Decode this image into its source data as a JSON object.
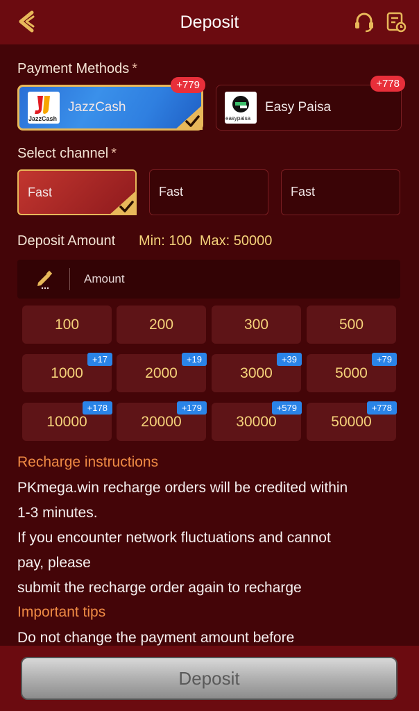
{
  "header": {
    "title": "Deposit"
  },
  "payment_methods": {
    "label": "Payment Methods",
    "required_mark": "*",
    "items": [
      {
        "name": "JazzCash",
        "logo_text": "JazzCash",
        "badge": "+779",
        "selected": true
      },
      {
        "name": "Easy Paisa",
        "logo_text": "easypaisa",
        "badge": "+778",
        "selected": false
      }
    ]
  },
  "channel": {
    "label": "Select channel",
    "required_mark": "*",
    "items": [
      {
        "label": "Fast",
        "selected": true
      },
      {
        "label": "Fast",
        "selected": false
      },
      {
        "label": "Fast",
        "selected": false
      }
    ]
  },
  "deposit_amount": {
    "label": "Deposit Amount",
    "limits": "Min: 100  Max: 50000",
    "input_placeholder": "Amount",
    "input_value": ""
  },
  "amounts": [
    {
      "value": "100",
      "bonus": ""
    },
    {
      "value": "200",
      "bonus": ""
    },
    {
      "value": "300",
      "bonus": ""
    },
    {
      "value": "500",
      "bonus": ""
    },
    {
      "value": "1000",
      "bonus": "+17"
    },
    {
      "value": "2000",
      "bonus": "+19"
    },
    {
      "value": "3000",
      "bonus": "+39"
    },
    {
      "value": "5000",
      "bonus": "+79"
    },
    {
      "value": "10000",
      "bonus": "+178"
    },
    {
      "value": "20000",
      "bonus": "+179"
    },
    {
      "value": "30000",
      "bonus": "+579"
    },
    {
      "value": "50000",
      "bonus": "+778"
    }
  ],
  "instructions": {
    "title": "Recharge instructions",
    "lines": [
      "PKmega.win recharge orders will be credited within",
      "1-3 minutes.",
      "If you encounter network fluctuations and cannot",
      "pay, please",
      "submit the recharge order again to recharge"
    ],
    "tips_title": "Important tips",
    "tips_lines": [
      "Do not change the payment amount before"
    ]
  },
  "footer": {
    "deposit_label": "Deposit"
  },
  "colors": {
    "header_bg": "#6b0b10",
    "page_bg": "#440508",
    "accent_gold": "#f5d27a",
    "badge_red": "#e82f3a",
    "badge_blue": "#2a84e8",
    "instruction_title": "#ef8a44"
  },
  "icons": {
    "back": "back-arrow-icon",
    "support": "headset-icon",
    "history": "history-icon",
    "pencil": "pencil-icon",
    "check": "checkmark-icon"
  }
}
